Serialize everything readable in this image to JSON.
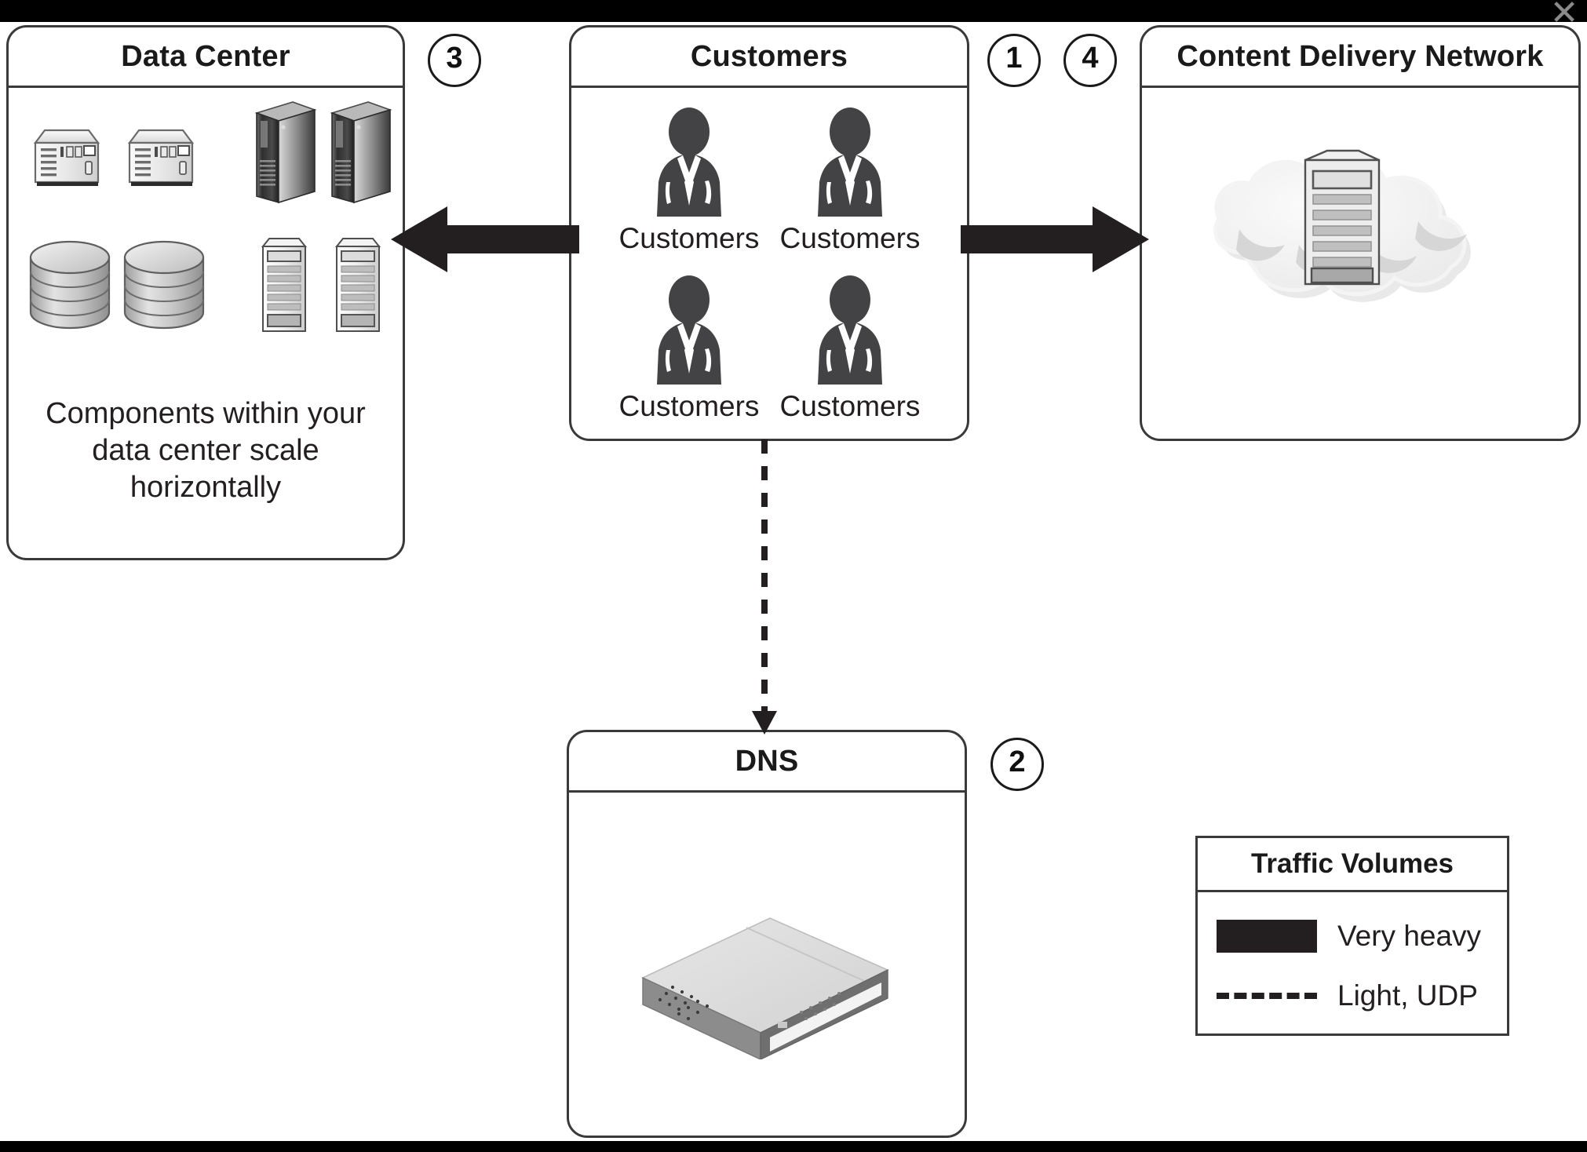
{
  "figure": {
    "kind": "network-architecture-diagram",
    "close_icon": "✕"
  },
  "panels": {
    "data_center": {
      "title": "Data Center",
      "caption": "Components within your\ndata center scale\nhorizontally",
      "caption_line1": "Components within your",
      "caption_line2": "data center scale",
      "caption_line3": "horizontally",
      "icons": [
        {
          "name": "network-appliance-icon",
          "label": "network appliance"
        },
        {
          "name": "network-appliance-icon",
          "label": "network appliance"
        },
        {
          "name": "server-tower-dark-icon",
          "label": "server tower"
        },
        {
          "name": "server-tower-dark-icon",
          "label": "server tower"
        },
        {
          "name": "database-cylinder-icon",
          "label": "database"
        },
        {
          "name": "database-cylinder-icon",
          "label": "database"
        },
        {
          "name": "server-rack-icon",
          "label": "server rack"
        },
        {
          "name": "server-rack-icon",
          "label": "server rack"
        }
      ]
    },
    "customers": {
      "title": "Customers",
      "people": [
        {
          "label": "Customers"
        },
        {
          "label": "Customers"
        },
        {
          "label": "Customers"
        },
        {
          "label": "Customers"
        }
      ]
    },
    "cdn": {
      "title": "Content Delivery Network",
      "icon": "cloud-with-server-icon"
    },
    "dns": {
      "title": "DNS",
      "icon": "network-switch-icon"
    }
  },
  "badges": [
    {
      "id": "badge-1",
      "label": "1"
    },
    {
      "id": "badge-2",
      "label": "2"
    },
    {
      "id": "badge-3",
      "label": "3"
    },
    {
      "id": "badge-4",
      "label": "4"
    }
  ],
  "connectors": [
    {
      "name": "customers-to-data-center",
      "style": "very-heavy",
      "direction": "left",
      "color": "#231f20"
    },
    {
      "name": "customers-to-cdn",
      "style": "very-heavy",
      "direction": "right",
      "color": "#231f20"
    },
    {
      "name": "customers-to-dns",
      "style": "light-udp",
      "direction": "down",
      "color": "#231f20"
    }
  ],
  "legend": {
    "title": "Traffic Volumes",
    "rows": [
      {
        "marker": "solid-bar",
        "label": "Very heavy"
      },
      {
        "marker": "dashed-line",
        "label": "Light, UDP"
      }
    ]
  },
  "colors": {
    "stroke": "#3a3a3c",
    "ink": "#231f20",
    "person": "#434345",
    "cloud": "#efefef",
    "background": "#ffffff"
  }
}
